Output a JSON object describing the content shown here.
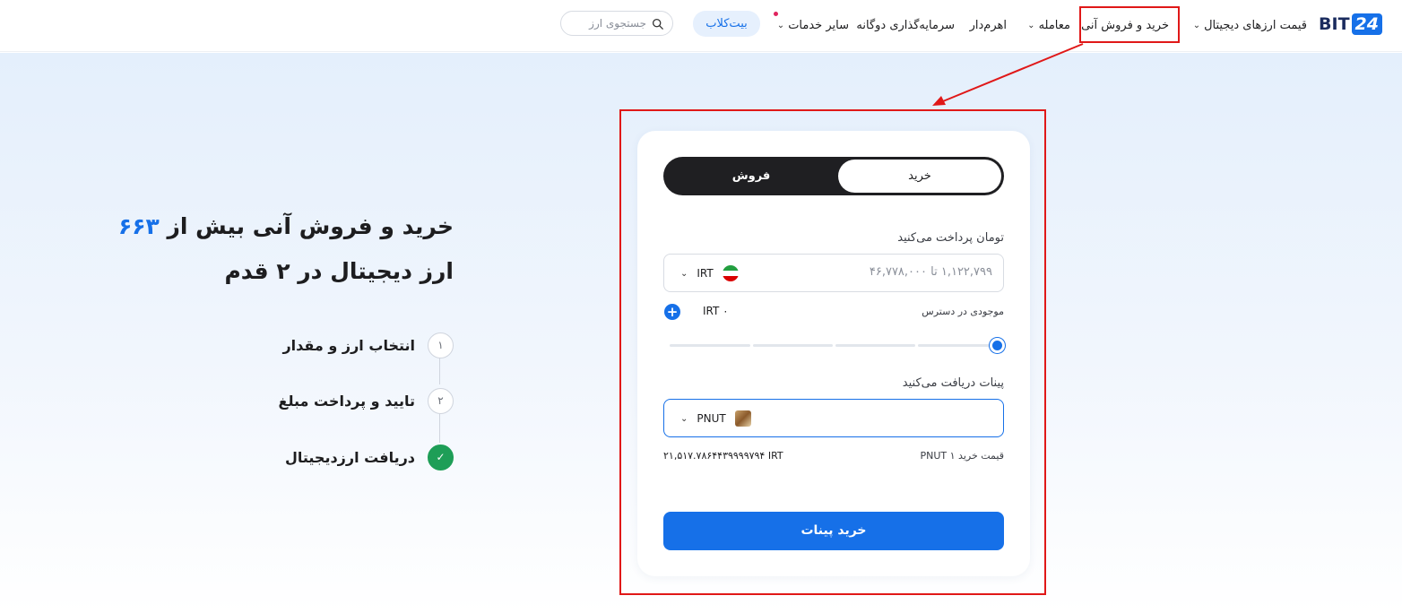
{
  "header": {
    "logo_text": "BIT",
    "logo_num": "24",
    "nav": {
      "prices": "قیمت ارزهای دیجیتال",
      "instant": "خرید و فروش آنی",
      "trade": "معامله",
      "leverage": "اهرم‌دار",
      "dual_invest": "سرمایه‌گذاری دوگانه",
      "other_services": "سایر خدمات"
    },
    "bitclub": "بیت‌کلاب",
    "search_placeholder": "جستجوی ارز"
  },
  "hero": {
    "title_part1": "خرید و فروش آنی بیش از",
    "title_count": "۶۶۳",
    "title_part2": "ارز دیجیتال در ۲ قدم",
    "steps": [
      {
        "num": "۱",
        "label": "انتخاب ارز و مقدار",
        "done": false
      },
      {
        "num": "۲",
        "label": "تایید و پرداخت مبلغ",
        "done": false
      },
      {
        "num": "✓",
        "label": "دریافت ارزدیجیتال",
        "done": true
      }
    ]
  },
  "card": {
    "tab_buy": "خرید",
    "tab_sell": "فروش",
    "pay_label": "تومان پرداخت می‌کنید",
    "pay_placeholder": "۱,۱۲۲,۷۹۹ تا ۴۶,۷۷۸,۰۰۰",
    "pay_currency": "IRT",
    "balance_label": "موجودی در دسترس",
    "balance_value": "IRT ۰",
    "slider_level": 1.0,
    "receive_label": "پینات دریافت می‌کنید",
    "receive_currency": "PNUT",
    "rate_label": "قیمت خرید ۱ PNUT",
    "rate_value": "۲۱,۵۱۷.۷۸۶۴۴۳۹۹۹۹۷۹۴ IRT",
    "buy_button": "خرید پینات"
  },
  "colors": {
    "accent": "#1670e8",
    "annotation": "#e01818",
    "success": "#1e9e57"
  }
}
